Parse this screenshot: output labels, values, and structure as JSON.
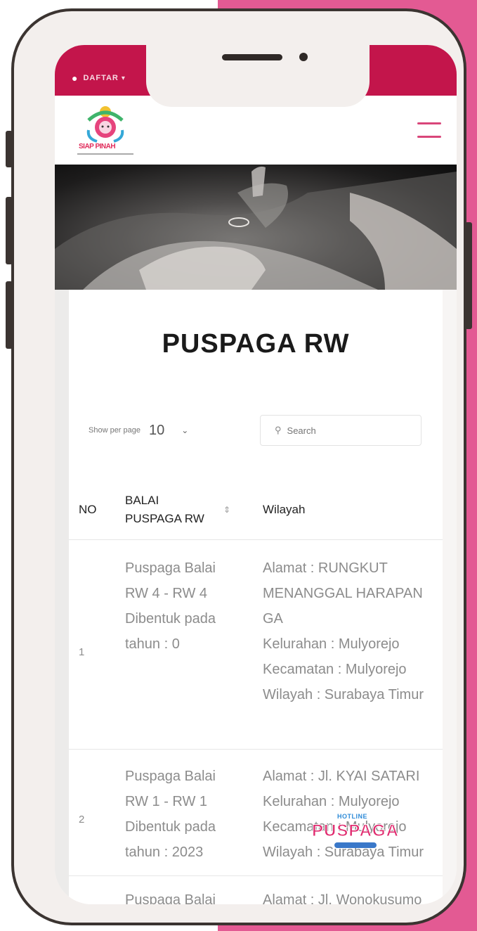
{
  "colors": {
    "brand_pink": "#e35a93",
    "top_bar": "#c3154b",
    "frame": "#3b3431",
    "accent": "#d9467a"
  },
  "topbar": {
    "user_icon": "user-icon",
    "label": "DAFTAR",
    "caret": "▾"
  },
  "navbar": {
    "logo_text": "SIAP PINAH",
    "menu_icon": "hamburger-icon"
  },
  "hero": {
    "alt": "hands-photo"
  },
  "page": {
    "title": "PUSPAGA RW"
  },
  "controls": {
    "show_per_page_label": "Show per page",
    "per_page_value": "10",
    "search_placeholder": "Search"
  },
  "table": {
    "headers": {
      "no": "NO",
      "balai": "BALAI PUSPAGA RW",
      "sort": "⇕",
      "wilayah": "Wilayah"
    },
    "rows": [
      {
        "no": "1",
        "balai": [
          "Puspaga Balai",
          "RW 4 - RW 4",
          "Dibentuk pada",
          "tahun : 0"
        ],
        "wilayah": [
          "Alamat : RUNGKUT",
          "MENANGGAL HARAPAN",
          "GA",
          "Kelurahan : Mulyorejo",
          "Kecamatan : Mulyorejo",
          "Wilayah : Surabaya Timur"
        ]
      },
      {
        "no": "2",
        "balai": [
          "Puspaga Balai",
          "RW 1 - RW 1",
          "Dibentuk pada",
          "tahun : 2023"
        ],
        "wilayah": [
          "Alamat : Jl. KYAI SATARI",
          "Kelurahan : Mulyorejo",
          "Kecamatan : Mulyorejo",
          "Wilayah : Surabaya Timur"
        ]
      },
      {
        "no": "",
        "balai": [
          "Puspaga Balai"
        ],
        "wilayah": [
          "Alamat : Jl. Wonokusumo"
        ]
      }
    ]
  },
  "badge": {
    "top": "HOTLINE",
    "main": "PUSPAGA"
  }
}
